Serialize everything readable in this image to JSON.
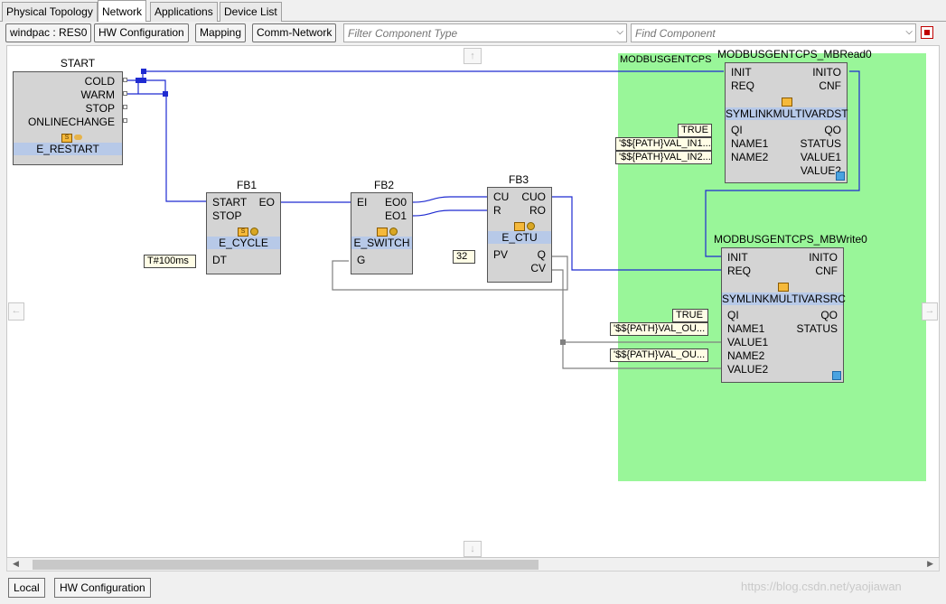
{
  "tabs": [
    "Physical Topology",
    "Network",
    "Applications",
    "Device List"
  ],
  "toolbar": {
    "resource": "windpac : RES0",
    "hw_config": "HW Configuration",
    "mapping": "Mapping",
    "comm_network": "Comm-Network",
    "filter_placeholder": "Filter Component Type",
    "find_placeholder": "Find Component"
  },
  "region": {
    "label": "MODBUSGENTCPS",
    "color": "#99f699"
  },
  "blocks": {
    "start": {
      "title": "START",
      "outputs": [
        "COLD",
        "WARM",
        "STOP",
        "ONLINECHANGE"
      ],
      "type": "E_RESTART",
      "icon": "s-service-icon"
    },
    "fb1": {
      "title": "FB1",
      "event_inputs": [
        "START",
        "STOP"
      ],
      "event_outputs": [
        "EO"
      ],
      "type": "E_CYCLE",
      "data_inputs": [
        "DT"
      ],
      "param_dt": "T#100ms"
    },
    "fb2": {
      "title": "FB2",
      "event_inputs": [
        "EI"
      ],
      "event_outputs": [
        "EO0",
        "EO1"
      ],
      "type": "E_SWITCH",
      "data_inputs": [
        "G"
      ]
    },
    "fb3": {
      "title": "FB3",
      "event_inputs": [
        "CU",
        "R"
      ],
      "event_outputs": [
        "CUO",
        "RO"
      ],
      "type": "E_CTU",
      "data_inputs": [
        "PV"
      ],
      "data_outputs": [
        "Q",
        "CV"
      ],
      "param_pv": "32"
    },
    "mbread": {
      "title": "MODBUSGENTCPS_MBRead0",
      "event_inputs": [
        "INIT",
        "REQ"
      ],
      "event_outputs": [
        "INITO",
        "CNF"
      ],
      "type": "SYMLINKMULTIVARDST",
      "data_inputs": [
        "QI",
        "NAME1",
        "NAME2"
      ],
      "data_outputs": [
        "QO",
        "STATUS",
        "VALUE1",
        "VALUE2"
      ],
      "param_qi": "TRUE",
      "param_name1": "'$${PATH}VAL_IN1...",
      "param_name2": "'$${PATH}VAL_IN2..."
    },
    "mbwrite": {
      "title": "MODBUSGENTCPS_MBWrite0",
      "event_inputs": [
        "INIT",
        "REQ"
      ],
      "event_outputs": [
        "INITO",
        "CNF"
      ],
      "type": "SYMLINKMULTIVARSRC",
      "data_inputs": [
        "QI",
        "NAME1",
        "VALUE1",
        "NAME2",
        "VALUE2"
      ],
      "data_outputs": [
        "QO",
        "STATUS"
      ],
      "param_qi": "TRUE",
      "param_name1": "'$${PATH}VAL_OU...",
      "param_name2": "'$${PATH}VAL_OU..."
    }
  },
  "bottom_tabs": [
    "Local",
    "HW Configuration"
  ],
  "watermark": "https://blog.csdn.net/yaojiawan",
  "colors": {
    "event_wire": "#1f2bd1",
    "data_wire": "#808080",
    "type_band": "#b7c9e8",
    "block_fill": "#d4d4d4"
  }
}
